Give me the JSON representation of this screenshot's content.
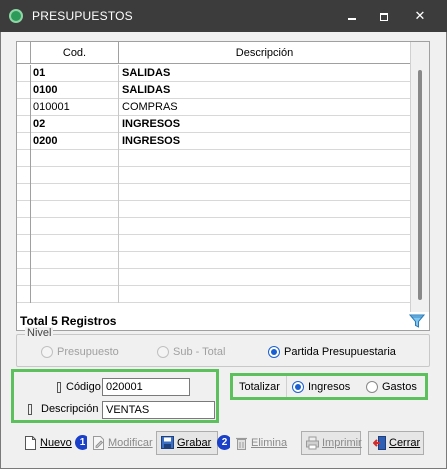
{
  "window": {
    "title": "PRESUPUESTOS"
  },
  "grid": {
    "columns": {
      "code": "Cod.",
      "description": "Descripción"
    },
    "rows": [
      {
        "code": "01",
        "description": "SALIDAS",
        "bold": true
      },
      {
        "code": "0100",
        "description": "SALIDAS",
        "bold": true
      },
      {
        "code": "010001",
        "description": "COMPRAS",
        "bold": false
      },
      {
        "code": "02",
        "description": "INGRESOS",
        "bold": true
      },
      {
        "code": "0200",
        "description": "INGRESOS",
        "bold": true
      }
    ],
    "empty_rows": 9,
    "total_text": "Total 5 Registros"
  },
  "nivel": {
    "legend": "Nivel",
    "options": [
      {
        "label": "Presupuesto",
        "enabled": false,
        "checked": false
      },
      {
        "label": "Sub - Total",
        "enabled": false,
        "checked": false
      },
      {
        "label": "Partida Presupuestaria",
        "enabled": true,
        "checked": true
      }
    ]
  },
  "form": {
    "codigo_label": "Código",
    "codigo_value": "020001",
    "descripcion_label": "Descripción",
    "descripcion_value": "VENTAS"
  },
  "totalizar": {
    "label": "Totalizar",
    "options": [
      {
        "label": "Ingresos",
        "checked": true
      },
      {
        "label": "Gastos",
        "checked": false
      }
    ]
  },
  "toolbar": {
    "nuevo": "Nuevo",
    "modificar": "Modificar",
    "grabar": "Grabar",
    "elimina": "Elimina",
    "imprimir": "Imprimir",
    "cerrar": "Cerrar",
    "badge_1": "1",
    "badge_2": "2"
  },
  "colors": {
    "highlight_green": "#5cc15c",
    "badge_blue": "#1a3fc8",
    "titlebar": "#3c3c3c"
  }
}
